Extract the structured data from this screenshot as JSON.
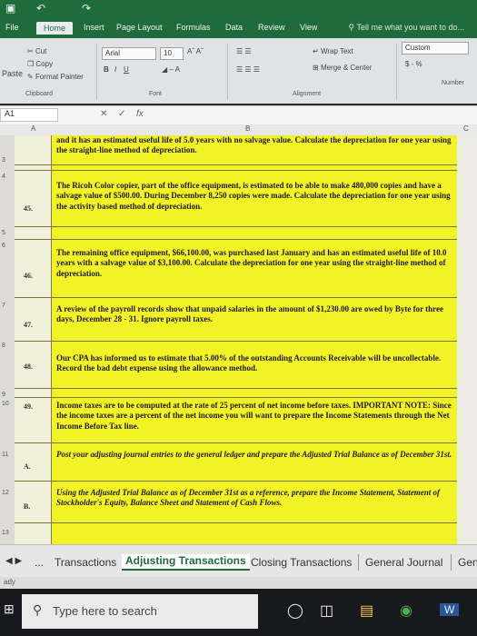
{
  "title_bar": {
    "save_icon": "▣",
    "undo_icon": "↶",
    "redo_icon": "↷"
  },
  "ribbon_tabs": [
    "File",
    "Home",
    "Insert",
    "Page Layout",
    "Formulas",
    "Data",
    "Review",
    "View"
  ],
  "tell_me": "Tell me what you want to do...",
  "clipboard": {
    "cut": "Cut",
    "copy": "Copy",
    "paste": "Paste",
    "format_painter": "Format Painter",
    "group": "Clipboard"
  },
  "font": {
    "name": "Arial",
    "size": "10",
    "bold": "B",
    "italic": "I",
    "underline": "U",
    "group": "Font"
  },
  "alignment": {
    "wrap": "Wrap Text",
    "merge": "Merge & Center",
    "group": "Alignment"
  },
  "number": {
    "format": "Custom",
    "symbols": "$ - %",
    "group": "Number"
  },
  "formula_bar": {
    "cell": "A1",
    "cancel": "✕",
    "enter": "✓",
    "fx": "fx"
  },
  "columns": [
    "A",
    "B",
    "C"
  ],
  "row_numbers": [
    "3",
    "4",
    "5",
    "6",
    "7",
    "8",
    "9",
    "10",
    "11",
    "12",
    "13"
  ],
  "rows": [
    {
      "num": "",
      "text": "and it has an estimated useful life of 5.0 years with no salvage value. Calculate the depreciation for one year using the straight-line method of depreciation."
    },
    {
      "num": "45.",
      "text": "The Ricoh Color copier, part of the office equipment, is estimated to be able to make 480,000 copies and have a salvage value of $500.00. During December 8,250 copies were made. Calculate the depreciation for one year using the activity based method of depreciation."
    },
    {
      "num": "46.",
      "text": "The remaining office equipment, $66,100.00, was purchased last January and has an estimated useful life of 10.0 years with a salvage value of $3,100.00. Calculate the depreciation for one year using the straight-line method of depreciation."
    },
    {
      "num": "47.",
      "text": "A review of the payroll records show that unpaid salaries in the amount of $1,230.00 are owed by Byte for three days, December 28 - 31. Ignore payroll taxes."
    },
    {
      "num": "48.",
      "text": "Our CPA has informed us to estimate that 5.00% of the outstanding Accounts Receivable will be uncollectable. Record the bad debt expense using the allowance method."
    },
    {
      "num": "49.",
      "text": "Income taxes are to be computed at the rate of 25 percent of net income before taxes. IMPORTANT NOTE: Since the income taxes are a percent of the net income you will want to prepare the Income Statements through the Net Income Before Tax line."
    },
    {
      "num": "A.",
      "text": "Post your adjusting journal entries to the general ledger and prepare the Adjusted Trial Balance as of December 31st."
    },
    {
      "num": "B.",
      "text": "Using the Adjusted Trial Balance as of December 31st as a reference, prepare the Income Statement, Statement of Stockholder's Equity, Balance Sheet and Statement of Cash Flows."
    }
  ],
  "sheet_tabs": [
    "Transactions",
    "Adjusting Transactions",
    "Closing Transactions",
    "General Journal",
    "Gen"
  ],
  "sheet_nav": {
    "ellipsis": "..."
  },
  "status": "ady",
  "taskbar": {
    "search_placeholder": "Type here to search",
    "word_label": "W"
  },
  "colors": {
    "excel_green": "#1f6b3c",
    "highlight": "#f3f227"
  }
}
